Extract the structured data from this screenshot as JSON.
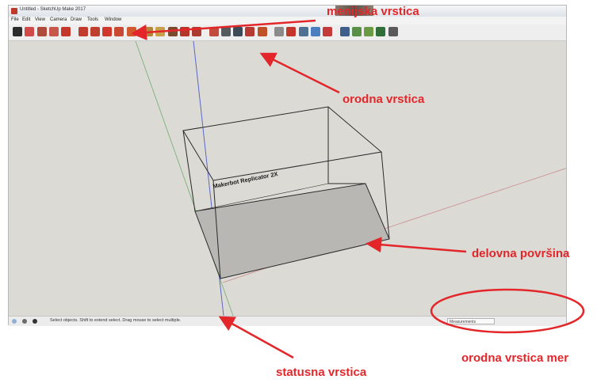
{
  "window": {
    "title": "Untitled - SketchUp Make 2017"
  },
  "menu": [
    "File",
    "Edit",
    "View",
    "Camera",
    "Draw",
    "Tools",
    "Window"
  ],
  "toolbar": {
    "tools": [
      {
        "icon": "select-arrow-icon",
        "color": "#2b2b2b"
      },
      {
        "icon": "eraser-icon",
        "color": "#d2494a"
      },
      {
        "icon": "pencil-icon",
        "color": "#b04a3a"
      },
      {
        "icon": "arc-icon",
        "color": "#c7574a"
      },
      {
        "icon": "shape-icon",
        "color": "#c6372b"
      },
      {
        "icon": "push-pull-icon",
        "color": "#c23b2f"
      },
      {
        "icon": "move-icon",
        "color": "#c0402f"
      },
      {
        "icon": "rotate-icon",
        "color": "#d0382e"
      },
      {
        "icon": "scale-icon",
        "color": "#c84a33"
      },
      {
        "icon": "offset-icon",
        "color": "#d35a2e"
      },
      {
        "icon": "tape-measure-icon",
        "color": "#b5863a"
      },
      {
        "icon": "text-icon",
        "color": "#c8a04a"
      },
      {
        "icon": "axes-icon",
        "color": "#7b4a2e"
      },
      {
        "icon": "paint-bucket-icon",
        "color": "#b4352a"
      },
      {
        "icon": "orbit-icon",
        "color": "#ab3b2f"
      },
      {
        "icon": "pan-icon",
        "color": "#c14b3c"
      },
      {
        "icon": "zoom-icon",
        "color": "#555a5f"
      },
      {
        "icon": "zoom-extents-icon",
        "color": "#3d4a57"
      },
      {
        "icon": "previous-view-icon",
        "color": "#b53a34"
      },
      {
        "icon": "position-camera-icon",
        "color": "#c0502a"
      },
      {
        "icon": "look-around-icon",
        "color": "#8b8b8b"
      },
      {
        "icon": "walk-icon",
        "color": "#c2362c"
      },
      {
        "icon": "warehouse-icon",
        "color": "#4f6f93"
      },
      {
        "icon": "extension-icon",
        "color": "#4b7fbf"
      },
      {
        "icon": "layout-icon",
        "color": "#c23a3a"
      },
      {
        "icon": "style-builder-icon",
        "color": "#3f5f8a"
      },
      {
        "icon": "sandbox-icon",
        "color": "#5a8f4a"
      },
      {
        "icon": "model-info-icon",
        "color": "#6b9a45"
      },
      {
        "icon": "geo-location-icon",
        "color": "#2f6f3a"
      },
      {
        "icon": "settings-icon",
        "color": "#5a5a5a"
      }
    ]
  },
  "viewport": {
    "label": "Makerbot Replicator 2X"
  },
  "statusbar": {
    "hint": "Select objects. Shift to extend select. Drag mouse to select multiple.",
    "measurements_label": "Measurements"
  },
  "annotations": {
    "menu_bar": "menijska  vrstica",
    "toolbar": "orodna vrstica",
    "workspace": "delovna površina",
    "status_bar": "statusna vrstica",
    "measurements_toolbar": "orodna vrstica mer",
    "arrow_color": "#e3262a"
  }
}
